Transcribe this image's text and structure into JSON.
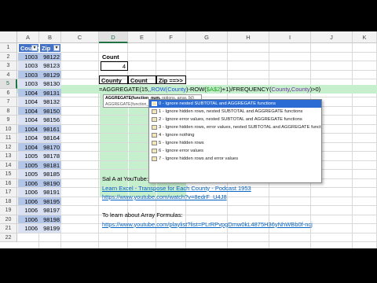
{
  "columns": [
    "A",
    "B",
    "C",
    "D",
    "E",
    "F",
    "G",
    "H",
    "I",
    "J",
    "K"
  ],
  "active_column": "D",
  "rows": [
    "1",
    "2",
    "3",
    "4",
    "5",
    "6",
    "7",
    "8",
    "9",
    "10",
    "11",
    "12",
    "13",
    "14",
    "15",
    "16",
    "17",
    "18",
    "19",
    "20",
    "21",
    "22"
  ],
  "active_row": "5",
  "table": {
    "header_county": "County",
    "header_zip": "Zip",
    "data": [
      [
        "1003",
        "98122"
      ],
      [
        "1003",
        "98123"
      ],
      [
        "1003",
        "98129"
      ],
      [
        "1003",
        "98130"
      ],
      [
        "1004",
        "98131"
      ],
      [
        "1004",
        "98132"
      ],
      [
        "1004",
        "98150"
      ],
      [
        "1004",
        "98156"
      ],
      [
        "1004",
        "98161"
      ],
      [
        "1004",
        "98164"
      ],
      [
        "1004",
        "98170"
      ],
      [
        "1005",
        "98178"
      ],
      [
        "1005",
        "98181"
      ],
      [
        "1005",
        "98185"
      ],
      [
        "1006",
        "98190"
      ],
      [
        "1006",
        "98191"
      ],
      [
        "1006",
        "98195"
      ],
      [
        "1006",
        "98197"
      ],
      [
        "1006",
        "98198"
      ],
      [
        "1006",
        "98199"
      ]
    ]
  },
  "count_block": {
    "label": "Count",
    "value": "4"
  },
  "output_headers": {
    "county": "County",
    "count": "Count",
    "zip": "Zip ==>>"
  },
  "formula": {
    "p1": "=AGGREGATE(15,",
    "p2": ",ROW(",
    "p3": "County",
    "p4": ")-ROW(",
    "p5": "$A$2",
    "p6": ")+1)/FREQUENCY(",
    "p7": "County",
    "p8": ",",
    "p9": "County",
    "p10": ")>0)"
  },
  "tooltip": {
    "line1_fn": "AGGREGATE(function_num,",
    "line1_args": " options, array, [k])",
    "line2": "AGGREGATE(function_num, options, ref1, ...)"
  },
  "autocomplete": [
    "0 - Ignore nested SUBTOTAL and AGGREGATE functions",
    "1 - Ignore hidden rows, nested SUBTOTAL and AGGREGATE functions",
    "2 - Ignore error values, nested SUBTOTAL and AGGREGATE functions",
    "3 - Ignore hidden rows, error values, nested SUBTOTAL and AGGREGATE functions",
    "4 - Ignore nothing",
    "5 - Ignore hidden rows",
    "6 - Ignore error values",
    "7 - Ignore hidden rows and error values"
  ],
  "notes": {
    "line1": "Sal A at YouTube:",
    "line2": "Learn Excel - Transpose for Each County - Podcast 1953",
    "line3": "https://www.youtube.com/watch?v=8edrF_U4J8",
    "line4": "To learn about Array Formulas:",
    "line5": "https://www.youtube.com/playlist?list=PLrRPvpgDmw0kL4875H36yNhWBb0f-ncj"
  },
  "colors": {
    "table_header": "#4472c4",
    "band_dark": "#b4c6e7",
    "band_light": "#d9e1f2",
    "green_fill": "#c6efce",
    "selection": "#2b6cd4"
  }
}
